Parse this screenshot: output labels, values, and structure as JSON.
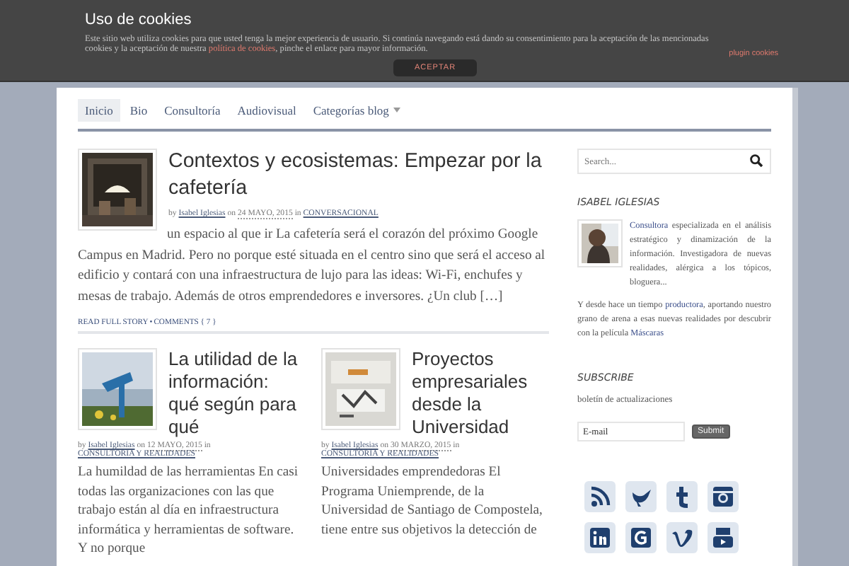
{
  "cookie_bar": {
    "title": "Uso de cookies",
    "text": [
      {
        "text": "Este sitio web utiliza cookies para que usted tenga la mejor experiencia de usuario. Si continúa navegando está dando su consentimiento para la aceptación de las mencionadas cookies y la aceptación de nuestra ",
        "link": false
      },
      {
        "text": "política de cookies",
        "link": true
      },
      {
        "text": ", pinche el enlace para mayor información.",
        "link": false
      }
    ],
    "plugin_link": "plugin cookies",
    "button": "ACEPTAR"
  },
  "nav": {
    "items": [
      {
        "label": "Inicio",
        "selected": true,
        "dropdown": false
      },
      {
        "label": "Bio",
        "selected": false,
        "dropdown": false
      },
      {
        "label": "Consultoría",
        "selected": false,
        "dropdown": false
      },
      {
        "label": "Audiovisual",
        "selected": false,
        "dropdown": false
      },
      {
        "label": "Categorías blog",
        "selected": false,
        "dropdown": true
      }
    ]
  },
  "posts": [
    {
      "title": "Contextos y ecosistemas: Empezar por la cafetería",
      "by": "by",
      "author": "Isabel Iglesias",
      "on": "on",
      "date": "24 MAYO, 2015",
      "in": "in",
      "category": "CONVERSACIONAL",
      "excerpt": "un espacio al que ir La cafetería será el corazón del próximo Google Campus en Madrid. Pero no porque esté situada en el centro sino que será el acceso al edificio y contará con una infraestructura de lujo para las ideas: Wi-Fi, enchufes y mesas de trabajo. Además de otros emprendedores e inversores. ¿Un club […]",
      "read_more": "READ FULL STORY",
      "separator": "•",
      "comments": "COMMENTS { 7 }"
    },
    {
      "title": "La utilidad de la información: qué según para qué",
      "by": "by",
      "author": "Isabel Iglesias",
      "on": "on",
      "date": "12 MAYO, 2015",
      "in": "in",
      "category": "CONSULTORÍA Y REALIDADES",
      "excerpt": "La humildad de las herramientas En casi todas las organizaciones con las que trabajo están al día en infraestructura informática y herramientas de software. Y no porque"
    },
    {
      "title": "Proyectos empresariales desde la Universidad",
      "by": "by",
      "author": "Isabel Iglesias",
      "on": "on",
      "date": "30 MARZO, 2015",
      "in": "in",
      "category": "CONSULTORÍA Y REALIDADES",
      "excerpt": "Universidades emprendedoras El Programa Uniemprende, de la Universidad de Santiago de Compostela, tiene entre sus objetivos la detección de"
    }
  ],
  "sidebar": {
    "search": {
      "placeholder": "Search..."
    },
    "author_heading": "ISABEL IGLESIAS",
    "bio": [
      [
        {
          "text": "Consultora",
          "link": true
        },
        {
          "text": " especializada en el análisis estratégico y dinamización de la información. Investigadora de nuevas realidades, alérgica a los tópicos, bloguera...",
          "link": false
        }
      ],
      [
        {
          "text": "Y desde hace un tiempo ",
          "link": false
        },
        {
          "text": "productora",
          "link": true
        },
        {
          "text": ", aportando nuestro grano de arena a esas nuevas realidades por descubrir con la película ",
          "link": false
        },
        {
          "text": "Máscaras",
          "link": true
        }
      ]
    ],
    "subscribe_heading": "SUBSCRIBE",
    "subscribe_label": "boletín de actualizaciones",
    "email": {
      "placeholder": "E-mail"
    },
    "submit": "Submit",
    "social": [
      {
        "kind": "rss"
      },
      {
        "kind": "twitter"
      },
      {
        "kind": "tumblr"
      },
      {
        "kind": "instagram"
      },
      {
        "kind": "linkedin"
      },
      {
        "kind": "google"
      },
      {
        "kind": "vimeo"
      },
      {
        "kind": "youtube"
      }
    ]
  }
}
